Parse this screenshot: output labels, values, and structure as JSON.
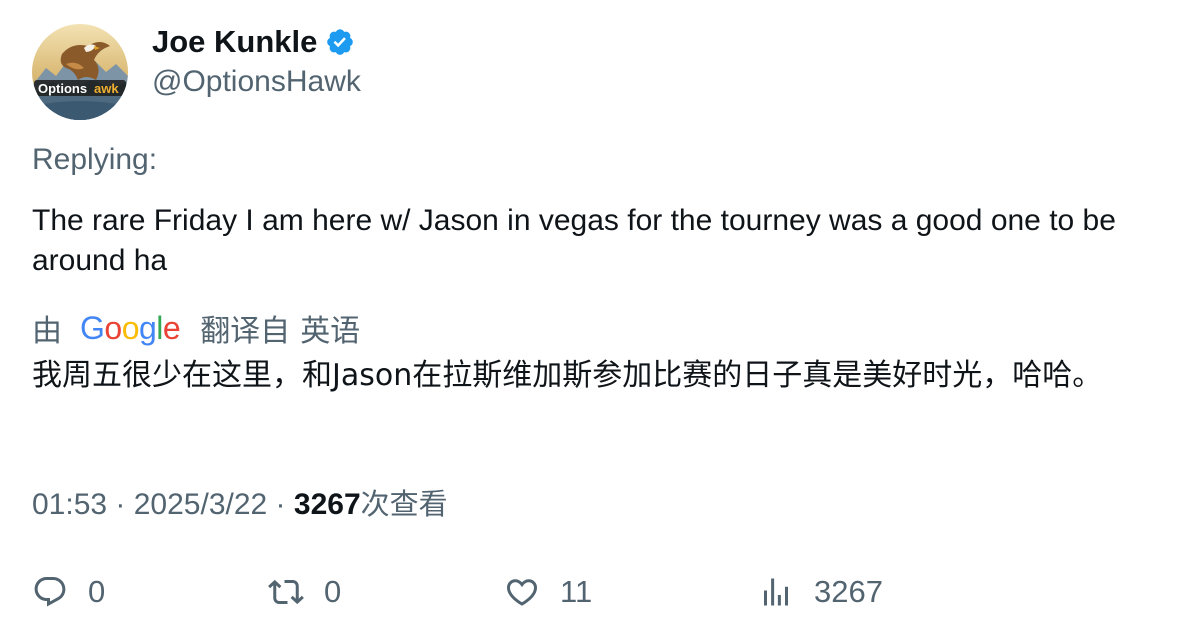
{
  "author": {
    "display_name": "Joe Kunkle",
    "handle": "@OptionsHawk",
    "verified": true,
    "avatar": {
      "icon": "hawk-logo-avatar",
      "logo_text_left": "Options",
      "logo_text_right": "awk"
    }
  },
  "reply_context": {
    "label": "Replying:"
  },
  "tweet": {
    "text": "The rare Friday I am here w/ Jason in vegas for the tourney was a good one to be around ha"
  },
  "translation": {
    "by_label": "由",
    "provider": "Google",
    "translated_from_label": "翻译自",
    "source_language": "英语",
    "text": "我周五很少在这里，和Jason在拉斯维加斯参加比赛的日子真是美好时光，哈哈。"
  },
  "meta": {
    "time": "01:53",
    "separator": " · ",
    "date": "2025/3/22",
    "views_count": "3267",
    "views_label": "次查看"
  },
  "actions": {
    "replies": "0",
    "retweets": "0",
    "likes": "11",
    "views": "3267"
  },
  "colors": {
    "text_primary": "#0f1419",
    "text_secondary": "#536471",
    "verified_badge": "#1d9bf0",
    "google_blue": "#4285f4",
    "google_red": "#ea4335",
    "google_yellow": "#fbbc05",
    "google_green": "#34a853"
  }
}
